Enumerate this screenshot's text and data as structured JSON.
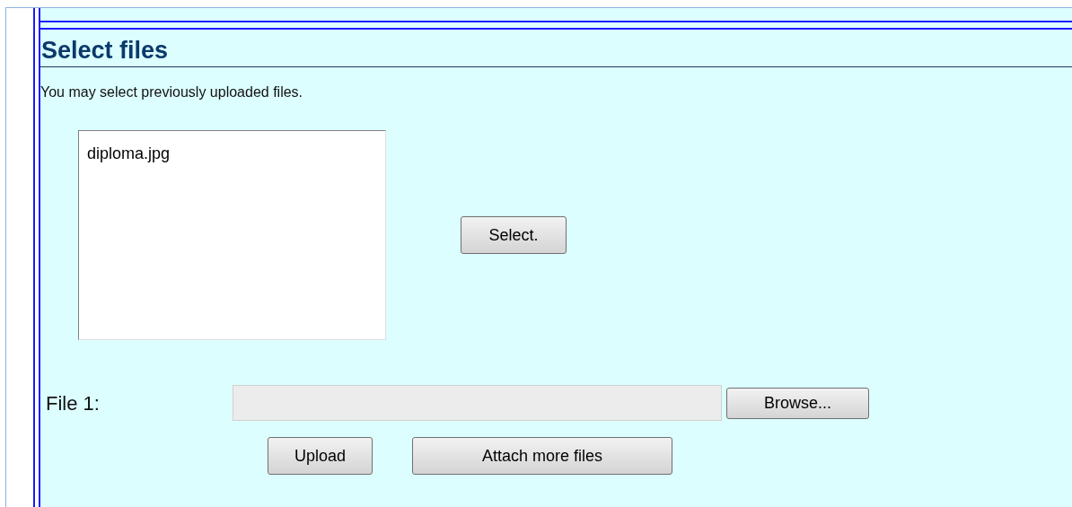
{
  "section": {
    "title": "Select files",
    "description": "You may select previously uploaded files."
  },
  "file_list": {
    "items": [
      {
        "label": "diploma.jpg",
        "selected": false
      }
    ]
  },
  "select_button": "Select.",
  "file_inputs": [
    {
      "label": "File 1:",
      "browse_button": "Browse..."
    }
  ],
  "buttons": [
    "Upload",
    "Attach more files"
  ]
}
